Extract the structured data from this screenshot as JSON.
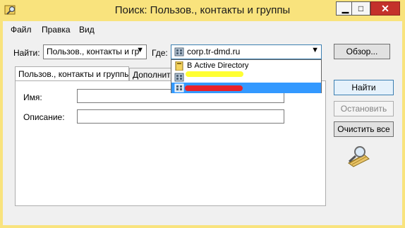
{
  "window": {
    "title": "Поиск: Пользов., контакты и группы"
  },
  "menu": [
    "Файл",
    "Правка",
    "Вид"
  ],
  "find": {
    "label": "Найти:",
    "value": "Пользов., контакты и гр"
  },
  "where": {
    "label": "Где:",
    "value": "corp.tr-dmd.ru"
  },
  "browse_button": "Обзор...",
  "dropdown": {
    "items": [
      "В Active Directory"
    ],
    "highlight_colors": [
      "#ffff33",
      "#e8222a"
    ]
  },
  "tabs": [
    "Пользов., контакты и группы",
    "Дополнительно"
  ],
  "form": {
    "name_label": "Имя:",
    "description_label": "Описание:"
  },
  "buttons": {
    "find": "Найти",
    "stop": "Остановить",
    "clear": "Очистить все"
  },
  "colors": {
    "titlebar": "#f9e37d",
    "selection": "#3399ff",
    "close": "#c4312b"
  },
  "icons": [
    "app-search-icon",
    "domain-icon",
    "active-directory-icon",
    "magnifier-icon"
  ]
}
